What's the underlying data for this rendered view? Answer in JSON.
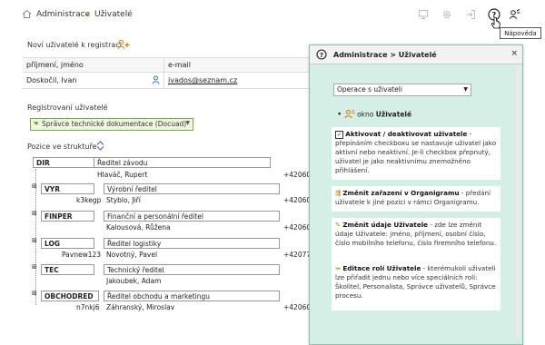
{
  "breadcrumb": {
    "root": "Administrace",
    "current": "Uživatelé"
  },
  "tooltip": "Nápověda",
  "new_users": {
    "title": "Noví uživatelé k registraci",
    "columns": [
      "příjmení, jméno",
      "e-mail"
    ],
    "rows": [
      {
        "name": "Doskočil, Ivan",
        "email": "ivados@seznam.cz"
      }
    ]
  },
  "registered": {
    "title": "Registrovaní uživatelé",
    "role_select": "Správce technické dokumentace (Docuad)"
  },
  "structure": {
    "title": "Pozice ve struktuře",
    "nodes": [
      {
        "code": "DIR",
        "position": "Ředitel závodu",
        "login": "",
        "person": "Hlaváč, Rupert",
        "phone": "+420601"
      },
      {
        "code": "VYR",
        "position": "Výrobní ředitel",
        "login": "k3kegp",
        "person": "Styblo, Jiří",
        "phone": "+420603"
      },
      {
        "code": "FINPER",
        "position": "Finanční a personální ředitel",
        "login": "",
        "person": "Kalousová, Růžena",
        "phone": "+420608"
      },
      {
        "code": "LOG",
        "position": "Ředitel logistiky",
        "login": "Pavnew123",
        "person": "Novotný, Pavel",
        "phone": "+42077"
      },
      {
        "code": "TEC",
        "position": "Technický ředitel",
        "login": "",
        "person": "Jakoubek, Adam",
        "phone": "+420603"
      },
      {
        "code": "OBCHODRED",
        "position": "Ředitel obchodu a marketingu",
        "login": "n7nkj6",
        "person": "Záhranský, Miroslav",
        "phone": "+42060"
      }
    ]
  },
  "help": {
    "title": "Administrace > Uživatelé",
    "select": "Operace s uživateli",
    "intro_pre": "okno",
    "intro_bold": "Uživatelé",
    "cards": [
      {
        "title": "Aktivovat / deaktivovat uživatele",
        "text": " - přepínáním checkboxu se nastavuje uživatel jako aktivní nebo neaktivní. Je-li checkbox přepnutý, uživatel je jako neaktivnímu znemožněno přihlášení."
      },
      {
        "title": "Změnit zařazení v Organigramu",
        "text": " - předání uživatele k jiné pozici v rámci Organigramu."
      },
      {
        "title": "Změnit údaje Uživatele",
        "text": " - zde lze změnit údaje Uživatele: jméno, příjmení, osobní číslo, číslo mobilního telefonu, číslo firemního telefonu."
      },
      {
        "title": "Editace rolí Uživatele",
        "text": " - kterémukoli uživateli lze přiřadit jednu nebo více speciálních rolí: Školitel, Personalista, Správce uživatelů, Správce procesu."
      }
    ]
  },
  "colors": {
    "accent": "#e07a00",
    "panel": "#d5eee6",
    "select_green": "#eef7e2"
  }
}
